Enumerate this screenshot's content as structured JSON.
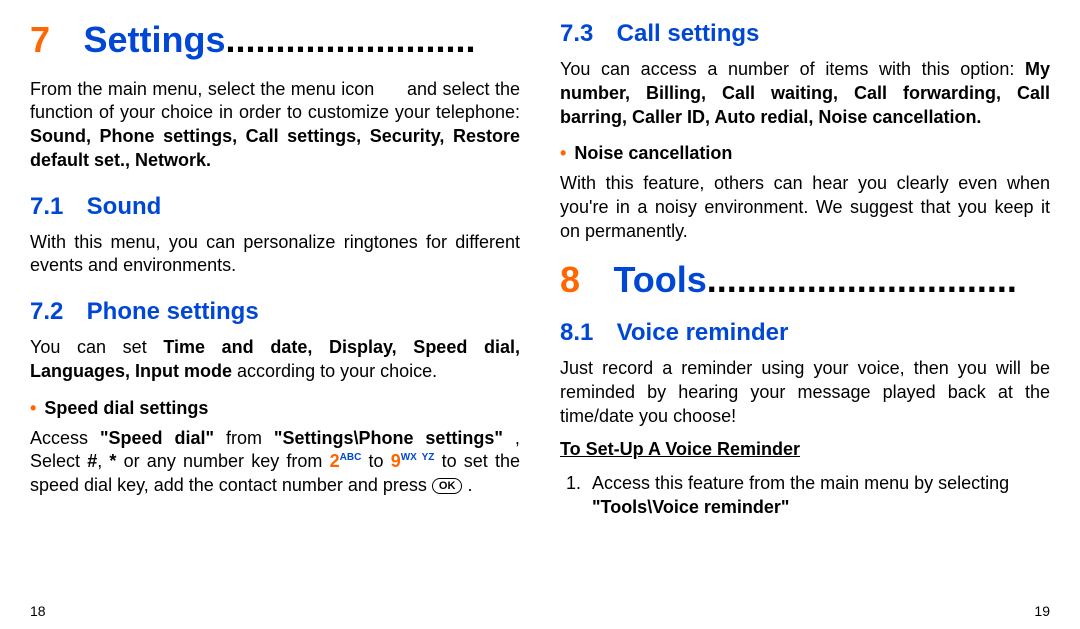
{
  "left": {
    "ch_num": "7",
    "ch_title": "Settings",
    "ch_dots": ".........................",
    "intro_a": "From the main menu, select the menu icon ",
    "intro_b": " and select the function of your choice in order to customize your telephone: ",
    "intro_bold": "Sound, Phone settings, Call settings, Security, Restore default set., Network.",
    "s71_num": "7.1",
    "s71_title": "Sound",
    "s71_body": "With this menu, you can personalize ringtones for different events and environments.",
    "s72_num": "7.2",
    "s72_title": "Phone settings",
    "s72_a": "You can set ",
    "s72_b": "Time and date, Display, Speed dial, Languages, Input mode",
    "s72_c": " according to your choice.",
    "sub_speed": "Speed dial settings",
    "sd_a": "Access ",
    "sd_b": "\"Speed dial\"",
    "sd_c": " from ",
    "sd_d": "\"Settings\\Phone settings\"",
    "sd_e": ", Select ",
    "key_hash": "#",
    "key_star": "*",
    "sd_eb": " or any number key from ",
    "key2": "2",
    "key2l": "ABC",
    "sd_f": " to ",
    "key9": "9",
    "key9l": "WX YZ",
    "sd_g": " to set the speed dial key, add the contact number and press ",
    "ok": "OK",
    "sd_h": ".",
    "page": "18"
  },
  "right": {
    "s73_num": "7.3",
    "s73_title": "Call settings",
    "s73_a": "You can access a number of items with this option: ",
    "s73_b": "My number, Billing, Call waiting, Call forwarding, Call barring, Caller ID, Auto redial, Noise cancellation.",
    "sub_noise": "Noise cancellation",
    "noise_body": "With this feature, others can hear you clearly even when you're in a noisy environment. We suggest that you keep it on permanently.",
    "ch_num": "8",
    "ch_title": "Tools",
    "ch_dots": "...............................",
    "s81_num": "8.1",
    "s81_title": "Voice reminder",
    "s81_body": "Just record a reminder using your voice, then you will be reminded by hearing your message played back at the time/date you choose!",
    "setup_title": "To Set-Up A Voice Reminder",
    "setup_1a": "Access this feature from the main menu by selecting ",
    "setup_1b": "\"Tools\\Voice reminder\"",
    "page": "19"
  }
}
